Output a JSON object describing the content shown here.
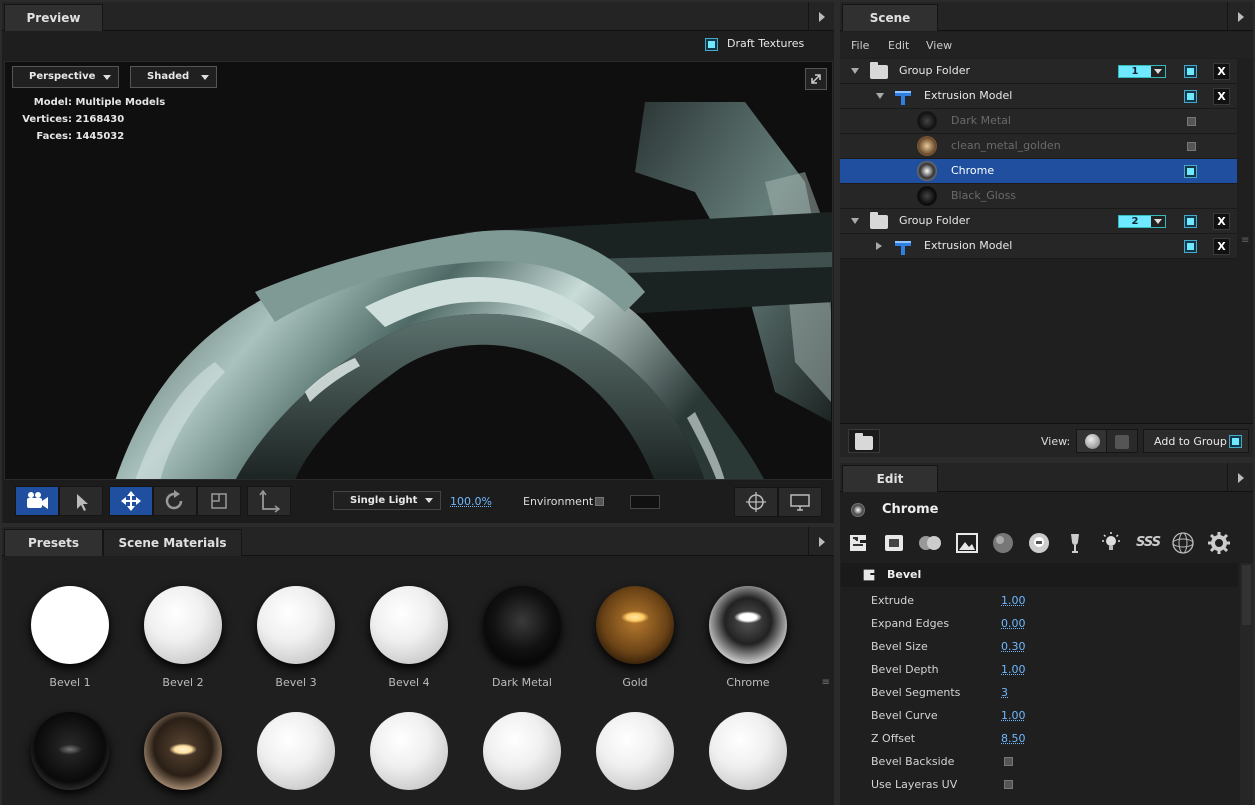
{
  "preview": {
    "tab": "Preview",
    "draft_textures": "Draft Textures",
    "camera_mode": "Perspective",
    "render_mode": "Shaded",
    "info": [
      {
        "key": "Model:",
        "value": "Multiple Models"
      },
      {
        "key": "Vertices:",
        "value": "2168430"
      },
      {
        "key": "Faces:",
        "value": "1445032"
      }
    ],
    "toolbar": {
      "light": "Single Light",
      "zoom": "100.0%",
      "environment": "Environment"
    }
  },
  "scene": {
    "tab": "Scene",
    "menu": [
      "File",
      "Edit",
      "View"
    ],
    "rows": [
      {
        "label": "Group Folder",
        "group": "1"
      },
      {
        "label": "Extrusion Model"
      },
      {
        "label": "Dark Metal"
      },
      {
        "label": "clean_metal_golden"
      },
      {
        "label": "Chrome"
      },
      {
        "label": "Black_Gloss"
      },
      {
        "label": "Group Folder",
        "group": "2"
      },
      {
        "label": "Extrusion Model"
      }
    ],
    "close_label": "X",
    "view_label": "View:",
    "add_to_group": "Add to Group"
  },
  "presets": {
    "tabs": [
      "Presets",
      "Scene Materials"
    ],
    "materials": [
      "Bevel 1",
      "Bevel 2",
      "Bevel 3",
      "Bevel 4",
      "Dark Metal",
      "Gold",
      "Chrome"
    ]
  },
  "edit": {
    "tab": "Edit",
    "material_name": "Chrome",
    "section": "Bevel",
    "properties": [
      {
        "label": "Extrude",
        "value": "1.00"
      },
      {
        "label": "Expand Edges",
        "value": "0.00"
      },
      {
        "label": "Bevel Size",
        "value": "0.30"
      },
      {
        "label": "Bevel Depth",
        "value": "1.00"
      },
      {
        "label": "Bevel Segments",
        "value": "3"
      },
      {
        "label": "Bevel Curve",
        "value": "1.00"
      },
      {
        "label": "Z Offset",
        "value": "8.50"
      },
      {
        "label": "Bevel Backside",
        "value": ""
      },
      {
        "label": "Use Layeras UV",
        "value": ""
      }
    ],
    "icons": [
      "bevel-icon",
      "inflate-icon",
      "toggle-icon",
      "image-icon",
      "sphere-icon",
      "reflection-icon",
      "wine-glass-icon",
      "light-bulb-icon",
      "sss-icon",
      "wireframe-sphere-icon",
      "gear-icon"
    ],
    "sss_text": "SSS"
  },
  "colors": {
    "accent": "#6fe9ff",
    "selection": "#1f4f9e",
    "link": "#6fb8ff"
  }
}
